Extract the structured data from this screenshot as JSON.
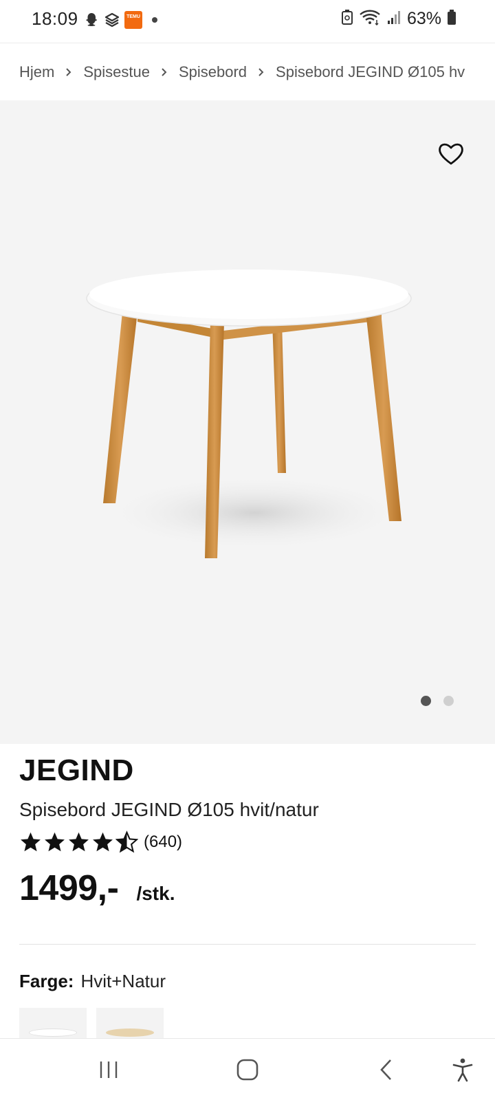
{
  "status_bar": {
    "time": "18:09",
    "temu_label": "TEMU",
    "battery": "63%"
  },
  "breadcrumb": {
    "items": [
      "Hjem",
      "Spisestue",
      "Spisebord",
      "Spisebord JEGIND Ø105 hv"
    ]
  },
  "product": {
    "brand": "JEGIND",
    "name": "Spisebord JEGIND Ø105 hvit/natur",
    "rating": 4.5,
    "review_count": "(640)",
    "price": "1499,-",
    "price_unit": "/stk.",
    "image_count": 2,
    "active_image": 1
  },
  "color": {
    "label": "Farge:",
    "value": "Hvit+Natur"
  },
  "colors": {
    "accent": "#111111",
    "hero_bg": "#f4f4f4",
    "table_top": "#f7f7f7",
    "table_legs": "#c98a3c",
    "temu_orange": "#f26a10"
  }
}
